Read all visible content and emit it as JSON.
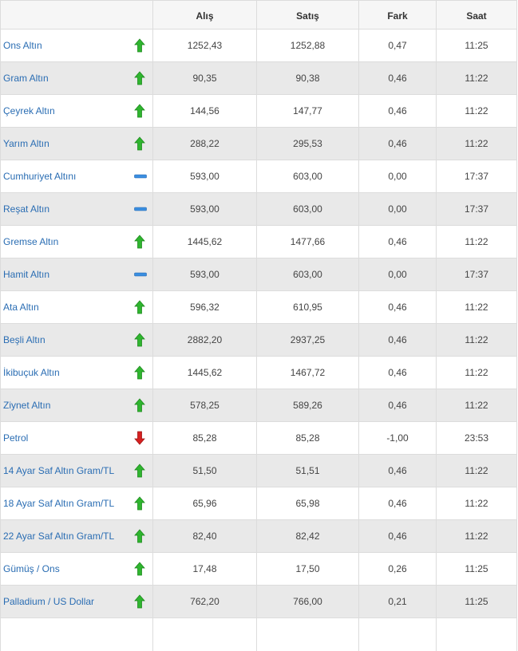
{
  "header": {
    "name": "",
    "buy": "Alış",
    "sell": "Satış",
    "diff": "Fark",
    "time": "Saat"
  },
  "colors": {
    "up": "#2fb52f",
    "down": "#d62020",
    "flat": "#3a8ee0",
    "link": "#2a6db3"
  },
  "rows": [
    {
      "name": "Ons Altın",
      "trend": "up-arrow-icon",
      "buy": "1252,43",
      "sell": "1252,88",
      "diff": "0,47",
      "time": "11:25"
    },
    {
      "name": "Gram Altın",
      "trend": "up-arrow-icon",
      "buy": "90,35",
      "sell": "90,38",
      "diff": "0,46",
      "time": "11:22"
    },
    {
      "name": "Çeyrek Altın",
      "trend": "up-arrow-icon",
      "buy": "144,56",
      "sell": "147,77",
      "diff": "0,46",
      "time": "11:22"
    },
    {
      "name": "Yarım Altın",
      "trend": "up-arrow-icon",
      "buy": "288,22",
      "sell": "295,53",
      "diff": "0,46",
      "time": "11:22"
    },
    {
      "name": "Cumhuriyet Altını",
      "trend": "flat-dash-icon",
      "buy": "593,00",
      "sell": "603,00",
      "diff": "0,00",
      "time": "17:37"
    },
    {
      "name": "Reşat Altın",
      "trend": "flat-dash-icon",
      "buy": "593,00",
      "sell": "603,00",
      "diff": "0,00",
      "time": "17:37"
    },
    {
      "name": "Gremse Altın",
      "trend": "up-arrow-icon",
      "buy": "1445,62",
      "sell": "1477,66",
      "diff": "0,46",
      "time": "11:22"
    },
    {
      "name": "Hamit Altın",
      "trend": "flat-dash-icon",
      "buy": "593,00",
      "sell": "603,00",
      "diff": "0,00",
      "time": "17:37"
    },
    {
      "name": "Ata Altın",
      "trend": "up-arrow-icon",
      "buy": "596,32",
      "sell": "610,95",
      "diff": "0,46",
      "time": "11:22"
    },
    {
      "name": "Beşli Altın",
      "trend": "up-arrow-icon",
      "buy": "2882,20",
      "sell": "2937,25",
      "diff": "0,46",
      "time": "11:22"
    },
    {
      "name": "İkibuçuk Altın",
      "trend": "up-arrow-icon",
      "buy": "1445,62",
      "sell": "1467,72",
      "diff": "0,46",
      "time": "11:22"
    },
    {
      "name": "Ziynet Altın",
      "trend": "up-arrow-icon",
      "buy": "578,25",
      "sell": "589,26",
      "diff": "0,46",
      "time": "11:22"
    },
    {
      "name": "Petrol",
      "trend": "down-arrow-icon",
      "buy": "85,28",
      "sell": "85,28",
      "diff": "-1,00",
      "time": "23:53"
    },
    {
      "name": "14 Ayar Saf Altın Gram/TL",
      "trend": "up-arrow-icon",
      "buy": "51,50",
      "sell": "51,51",
      "diff": "0,46",
      "time": "11:22"
    },
    {
      "name": "18 Ayar Saf Altın Gram/TL",
      "trend": "up-arrow-icon",
      "buy": "65,96",
      "sell": "65,98",
      "diff": "0,46",
      "time": "11:22"
    },
    {
      "name": "22 Ayar Saf Altın Gram/TL",
      "trend": "up-arrow-icon",
      "buy": "82,40",
      "sell": "82,42",
      "diff": "0,46",
      "time": "11:22"
    },
    {
      "name": "Gümüş / Ons",
      "trend": "up-arrow-icon",
      "buy": "17,48",
      "sell": "17,50",
      "diff": "0,26",
      "time": "11:25"
    },
    {
      "name": "Palladium / US Dollar",
      "trend": "up-arrow-icon",
      "buy": "762,20",
      "sell": "766,00",
      "diff": "0,21",
      "time": "11:25"
    }
  ]
}
